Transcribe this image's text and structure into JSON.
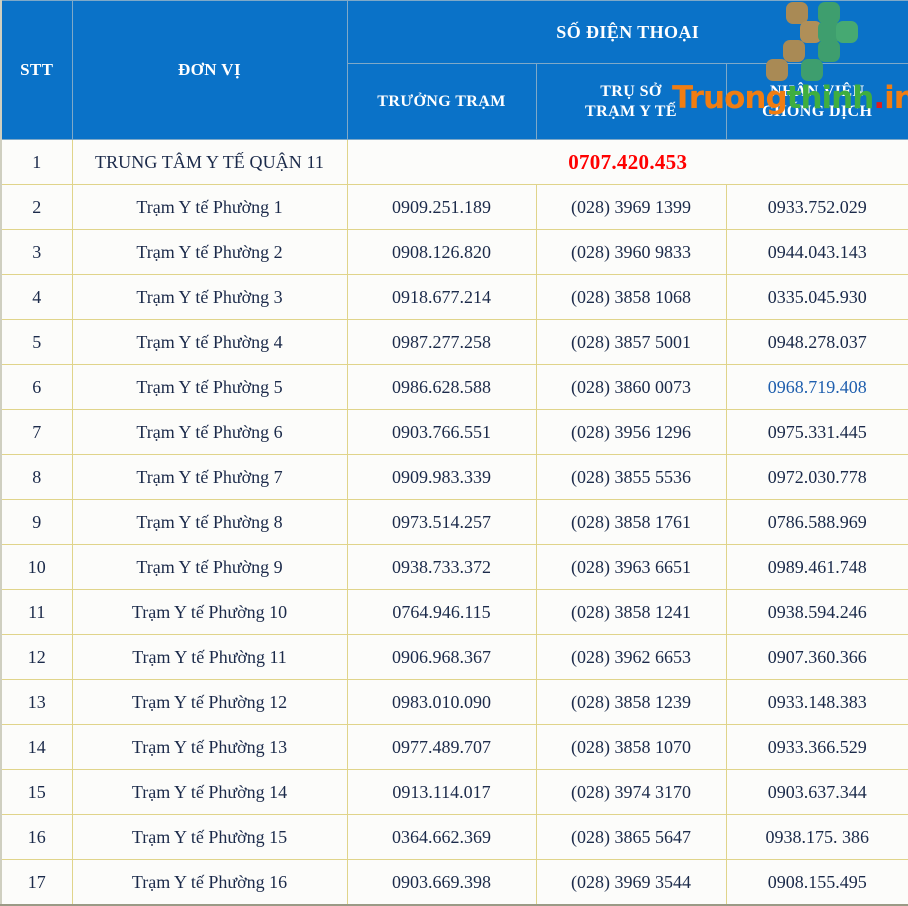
{
  "table": {
    "columns": {
      "stt": "STT",
      "unit": "ĐƠN VỊ",
      "phone_group": "SỐ ĐIỆN THOẠI",
      "head": "TRƯỞNG TRẠM",
      "office_line1": "TRỤ SỞ",
      "office_line2": "TRẠM Y TẾ",
      "staff_line1": "NHÂN VIÊN",
      "staff_line2": "CHỐNG DỊCH"
    },
    "rows": [
      {
        "stt": "1",
        "unit": "TRUNG TÂM Y TẾ QUẬN 11",
        "merged": true,
        "merged_value": "0707.420.453",
        "merged_color": "#FF0000"
      },
      {
        "stt": "2",
        "unit": "Trạm Y tế Phường 1",
        "head": "0909.251.189",
        "office": "(028) 3969 1399",
        "staff": "0933.752.029"
      },
      {
        "stt": "3",
        "unit": "Trạm Y tế Phường 2",
        "head": "0908.126.820",
        "office": "(028) 3960 9833",
        "staff": "0944.043.143"
      },
      {
        "stt": "4",
        "unit": "Trạm Y tế Phường 3",
        "head": "0918.677.214",
        "office": "(028) 3858 1068",
        "staff": "0335.045.930"
      },
      {
        "stt": "5",
        "unit": "Trạm Y tế Phường 4",
        "head": "0987.277.258",
        "office": "(028) 3857 5001",
        "staff": "0948.278.037"
      },
      {
        "stt": "6",
        "unit": "Trạm Y tế Phường 5",
        "head": "0986.628.588",
        "office": "(028) 3860 0073",
        "staff": "0968.719.408",
        "staff_color": "#1F5FAE"
      },
      {
        "stt": "7",
        "unit": "Trạm Y tế Phường 6",
        "head": "0903.766.551",
        "office": "(028) 3956 1296",
        "staff": "0975.331.445"
      },
      {
        "stt": "8",
        "unit": "Trạm Y tế Phường 7",
        "head": "0909.983.339",
        "office": "(028) 3855 5536",
        "staff": "0972.030.778"
      },
      {
        "stt": "9",
        "unit": "Trạm Y tế Phường 8",
        "head": "0973.514.257",
        "office": "(028) 3858 1761",
        "staff": "0786.588.969"
      },
      {
        "stt": "10",
        "unit": "Trạm Y tế Phường 9",
        "head": "0938.733.372",
        "office": "(028) 3963 6651",
        "staff": "0989.461.748"
      },
      {
        "stt": "11",
        "unit": "Trạm Y tế Phường 10",
        "head": "0764.946.115",
        "office": "(028) 3858 1241",
        "staff": "0938.594.246"
      },
      {
        "stt": "12",
        "unit": "Trạm Y tế Phường 11",
        "head": "0906.968.367",
        "office": "(028) 3962 6653",
        "staff": "0907.360.366"
      },
      {
        "stt": "13",
        "unit": "Trạm Y tế Phường 12",
        "head": "0983.010.090",
        "office": "(028) 3858 1239",
        "staff": "0933.148.383"
      },
      {
        "stt": "14",
        "unit": "Trạm Y tế Phường 13",
        "head": "0977.489.707",
        "office": "(028) 3858 1070",
        "staff": "0933.366.529"
      },
      {
        "stt": "15",
        "unit": "Trạm Y tế Phường 14",
        "head": "0913.114.017",
        "office": "(028) 3974 3170",
        "staff": "0903.637.344"
      },
      {
        "stt": "16",
        "unit": "Trạm Y tế Phường 15",
        "head": "0364.662.369",
        "office": "(028) 3865 5647",
        "staff": "0938.175. 386"
      },
      {
        "stt": "17",
        "unit": "Trạm Y tế Phường 16",
        "head": "0903.669.398",
        "office": "(028) 3969 3544",
        "staff": "0908.155.495"
      }
    ]
  },
  "watermark": {
    "part1": "Truong",
    "part2": "thinh",
    "dot": ".",
    "part3": "info",
    "colors": {
      "orange": "#F07D12",
      "green": "#3FAE3F",
      "red": "#E01B1B",
      "logo_tan": "#A98A55",
      "logo_green": "#3E9E6E"
    }
  },
  "colors": {
    "header_blue": "#0A72C8",
    "border_yellow": "#E0D48A",
    "text_navy": "#1B2A4A",
    "accent_red": "#FF0000",
    "accent_blue": "#1F5FAE"
  }
}
